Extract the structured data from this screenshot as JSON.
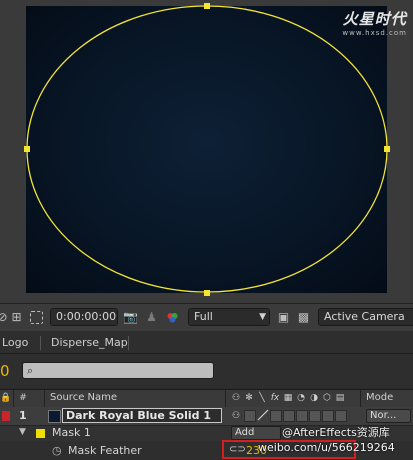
{
  "watermark": {
    "logo": "火星时代",
    "site": "www.hxsd.com",
    "channel": "@AfterEffects资源库",
    "weibo": "weibo.com/u/566219264"
  },
  "viewer_toolbar": {
    "timecode": "0:00:00:00",
    "resolution": "Full",
    "camera": "Active Camera"
  },
  "tabs": [
    {
      "label": "Logo"
    },
    {
      "label": "Disperse_Map"
    }
  ],
  "timeline": {
    "time_digit": "0",
    "search": {
      "value": "",
      "placeholder": ""
    }
  },
  "columns": {
    "source_name": "Source Name",
    "mode": "Mode"
  },
  "layer": {
    "index": "1",
    "name": "Dark Royal Blue Solid 1",
    "mode": "Nor...",
    "label_color": "#c8262c",
    "solid_color": "#0b1a33"
  },
  "mask": {
    "name": "Mask 1",
    "mode": "Add",
    "color": "#f0e000"
  },
  "mask_feather": {
    "label": "Mask Feather",
    "value": "230"
  },
  "colors": {
    "mask_path": "#f3e436",
    "accent_time": "#e9b800",
    "highlight": "#d02020"
  }
}
